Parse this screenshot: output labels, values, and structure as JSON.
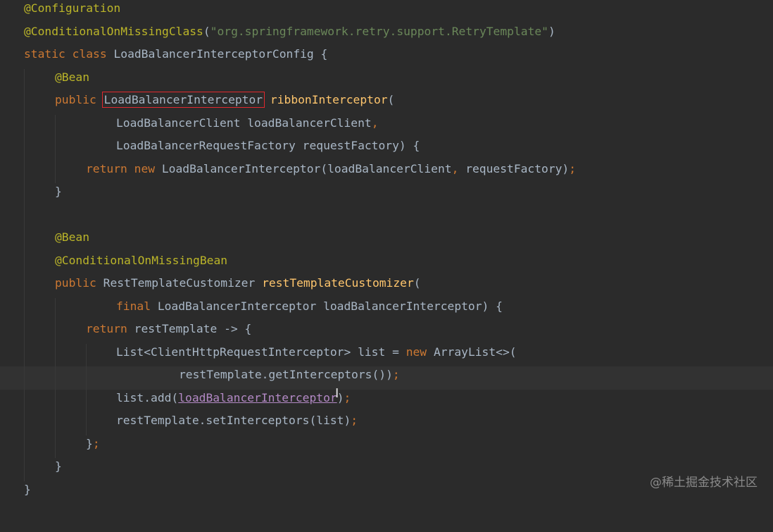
{
  "code": {
    "l1_annotation": "@Configuration",
    "l2_annotation": "@ConditionalOnMissingClass",
    "l2_paren_open": "(",
    "l2_string": "\"org.springframework.retry.support.RetryTemplate\"",
    "l2_paren_close": ")",
    "l3_static": "static",
    "l3_class": "class",
    "l3_name": "LoadBalancerInterceptorConfig {",
    "l4_annotation": "@Bean",
    "l5_public": "public",
    "l5_type": "LoadBalancerInterceptor",
    "l5_method": "ribbonInterceptor",
    "l5_paren": "(",
    "l6_param": "LoadBalancerClient loadBalancerClient",
    "l6_comma": ",",
    "l7_param": "LoadBalancerRequestFactory requestFactory) {",
    "l8_return": "return",
    "l8_new": "new",
    "l8_call": "LoadBalancerInterceptor(loadBalancerClient",
    "l8_comma": ",",
    "l8_rest": "requestFactory)",
    "l8_semi": ";",
    "l9_close": "}",
    "l11_annotation": "@Bean",
    "l12_annotation": "@ConditionalOnMissingBean",
    "l13_public": "public",
    "l13_type": "RestTemplateCustomizer",
    "l13_method": "restTemplateCustomizer",
    "l13_paren": "(",
    "l14_final": "final",
    "l14_param": "LoadBalancerInterceptor loadBalancerInterceptor) {",
    "l15_return": "return",
    "l15_lambda": "restTemplate -> {",
    "l16_decl": "List<ClientHttpRequestInterceptor> list =",
    "l16_new": "new",
    "l16_call": "ArrayList<>(",
    "l17_call": "restTemplate.getInterceptors())",
    "l17_semi": ";",
    "l18_call": "list.add(",
    "l18_arg": "loadBalancerInterceptor",
    "l18_close": ")",
    "l18_semi": ";",
    "l19_call": "restTemplate.setInterceptors(list)",
    "l19_semi": ";",
    "l20_close": "}",
    "l20_semi": ";",
    "l21_close": "}",
    "l22_close": "}"
  },
  "watermark": "@稀土掘金技术社区",
  "colors": {
    "background": "#2b2b2b",
    "annotation": "#bbb529",
    "keyword": "#cc7832",
    "string": "#6a8759",
    "method": "#ffc66d",
    "text": "#a9b7c6",
    "highlight_box": "#e0282e"
  }
}
